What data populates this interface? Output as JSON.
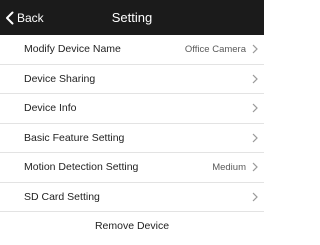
{
  "navbar": {
    "back_label": "Back",
    "title": "Setting",
    "background": "#1b1b1b"
  },
  "settings": [
    {
      "label": "Modify Device Name",
      "value": "Office Camera",
      "icon": "chevron-right-icon"
    },
    {
      "label": "Device Sharing",
      "value": "",
      "icon": "chevron-right-icon"
    },
    {
      "label": "Device Info",
      "value": "",
      "icon": "chevron-right-icon"
    },
    {
      "label": "Basic Feature Setting",
      "value": "",
      "icon": "chevron-right-icon"
    },
    {
      "label": "Motion Detection Setting",
      "value": "Medium",
      "icon": "chevron-right-icon"
    },
    {
      "label": "SD Card Setting",
      "value": "",
      "icon": "chevron-right-icon"
    }
  ],
  "remove_label": "Remove Device"
}
